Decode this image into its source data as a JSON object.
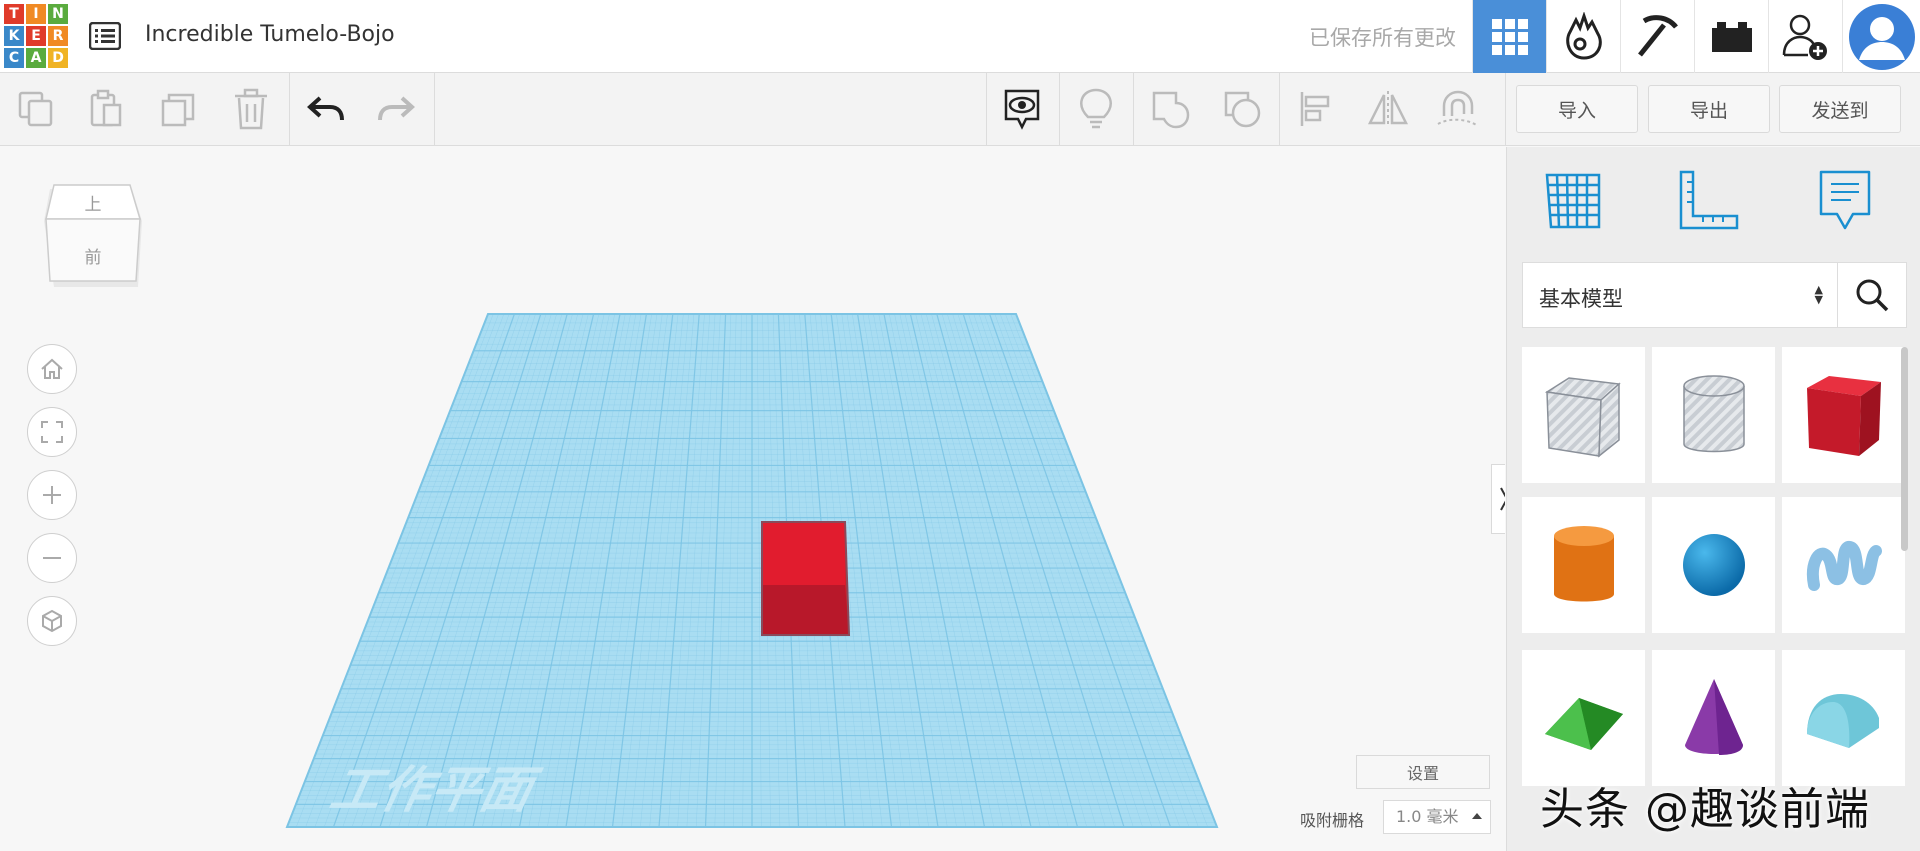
{
  "logo": {
    "letters": [
      "T",
      "I",
      "N",
      "K",
      "E",
      "R",
      "C",
      "A",
      "D"
    ],
    "colors": [
      "#e03b2a",
      "#f08a24",
      "#5aab3e",
      "#3a88c9",
      "#e03b2a",
      "#f08a24",
      "#3a88c9",
      "#5aab3e",
      "#f0b324"
    ]
  },
  "header": {
    "project_title": "Incredible Tumelo-Bojo",
    "save_status": "已保存所有更改",
    "modes": [
      {
        "name": "3d-design",
        "icon": "grid-icon",
        "active": true
      },
      {
        "name": "blocks",
        "icon": "blocks-icon"
      },
      {
        "name": "bricks",
        "icon": "pickaxe-icon"
      },
      {
        "name": "lego",
        "icon": "brick-icon"
      },
      {
        "name": "invite",
        "icon": "add-user-icon"
      },
      {
        "name": "profile",
        "icon": "avatar-icon"
      }
    ]
  },
  "toolbar": {
    "import_label": "导入",
    "export_label": "导出",
    "send_label": "发送到"
  },
  "viewcube": {
    "top_label": "上",
    "front_label": "前"
  },
  "workplane": {
    "label": "工作平面",
    "color": "#9fd6ee",
    "line_color": "#6fbde0"
  },
  "viewport_controls": {
    "settings_label": "设置",
    "snap_label": "吸附栅格",
    "snap_value": "1.0 毫米"
  },
  "panel": {
    "category": "基本模型",
    "shapes": [
      {
        "name": "box-hole",
        "icon": "hole-box-icon"
      },
      {
        "name": "cylinder-hole",
        "icon": "hole-cylinder-icon"
      },
      {
        "name": "box",
        "icon": "box-icon",
        "color": "#d42030"
      },
      {
        "name": "cylinder",
        "icon": "cylinder-icon",
        "color": "#e67818"
      },
      {
        "name": "sphere",
        "icon": "sphere-icon",
        "color": "#1d8fd0"
      },
      {
        "name": "scribble",
        "icon": "scribble-icon",
        "color": "#8fc3e8"
      },
      {
        "name": "roof",
        "icon": "roof-icon",
        "color": "#3aa83a"
      },
      {
        "name": "cone",
        "icon": "cone-icon",
        "color": "#8a3aa8"
      },
      {
        "name": "round-roof",
        "icon": "round-roof-icon",
        "color": "#6ec6d8"
      }
    ]
  },
  "watermark": "头条 @趣谈前端"
}
